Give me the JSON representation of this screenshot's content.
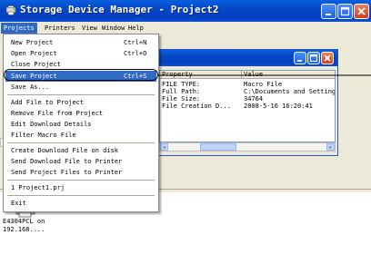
{
  "window": {
    "title": "Storage Device Manager - Project2"
  },
  "menubar": {
    "items": [
      "Projects",
      "Printers",
      "View",
      "Window",
      "Help"
    ]
  },
  "projects_menu": {
    "items": [
      {
        "label": "New Project",
        "shortcut": "Ctrl+N"
      },
      {
        "label": "Open Project",
        "shortcut": "Ctrl+O"
      },
      {
        "label": "Close Project",
        "shortcut": ""
      },
      {
        "label": "Save Project",
        "shortcut": "Ctrl+S"
      },
      {
        "label": "Save As...",
        "shortcut": ""
      },
      {
        "label": "Add File to Project",
        "shortcut": ""
      },
      {
        "label": "Remove File from Project",
        "shortcut": ""
      },
      {
        "label": "Edit Download Details",
        "shortcut": ""
      },
      {
        "label": "Filter Macro File",
        "shortcut": ""
      },
      {
        "label": "Create Download File on disk",
        "shortcut": ""
      },
      {
        "label": "Send Download File to Printer",
        "shortcut": ""
      },
      {
        "label": "Send Project Files to Printer",
        "shortcut": ""
      },
      {
        "label": "1 Project1.prj",
        "shortcut": ""
      },
      {
        "label": "Exit",
        "shortcut": ""
      }
    ],
    "highlighted": "Save Project"
  },
  "properties": {
    "headers": [
      "Property",
      "Value"
    ],
    "rows": [
      {
        "property": "FILE TYPE:",
        "value": "Macro File"
      },
      {
        "property": "Full Path:",
        "value": "C:\\Documents and Settings\\Ad"
      },
      {
        "property": "File Size:",
        "value": "34764"
      },
      {
        "property": "File Creation D...",
        "value": "2008-5-16 16:20:41"
      }
    ]
  },
  "lower_pane": {
    "printer_label": "E4304PCL on\n192.168...."
  },
  "colors": {
    "titlebar": "#0447c4",
    "menu_highlight": "#316ac5",
    "window_bg": "#ece9d8"
  }
}
